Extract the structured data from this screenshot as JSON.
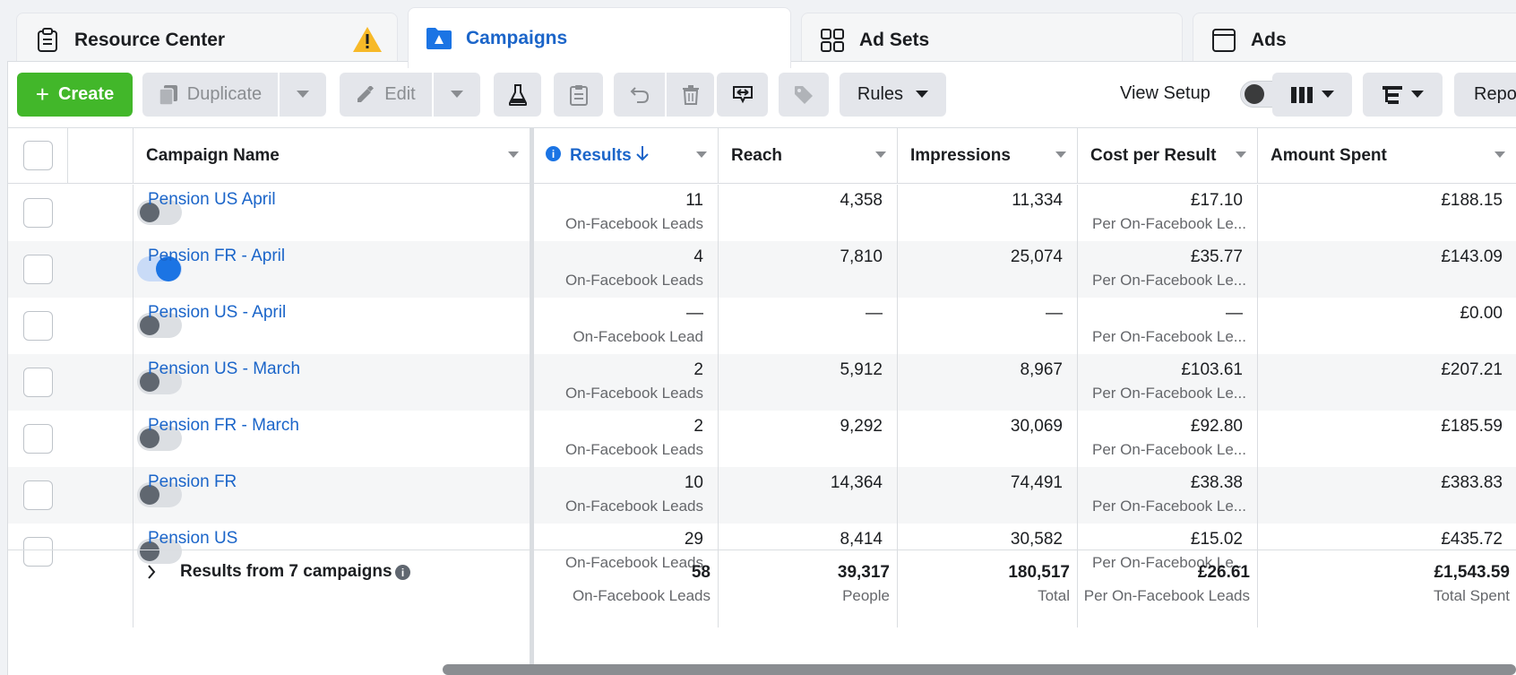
{
  "tabs": [
    {
      "label": "Resource Center",
      "icon": "clipboard-icon"
    },
    {
      "label": "Campaigns",
      "icon": "folder-icon"
    },
    {
      "label": "Ad Sets",
      "icon": "grid-icon"
    },
    {
      "label": "Ads",
      "icon": "ad-frame-icon"
    }
  ],
  "toolbar": {
    "create_label": "Create",
    "duplicate_label": "Duplicate",
    "edit_label": "Edit",
    "rules_label": "Rules",
    "view_setup_label": "View Setup",
    "reports_label": "Reports"
  },
  "columns": {
    "campaign_name": "Campaign Name",
    "results": "Results",
    "reach": "Reach",
    "impressions": "Impressions",
    "cost_per_result": "Cost per Result",
    "amount_spent": "Amount Spent"
  },
  "rows": [
    {
      "name": "Pension US April",
      "on": false,
      "results": "11",
      "results_sub": "On-Facebook Leads",
      "reach": "4,358",
      "impressions": "11,334",
      "cpr": "£17.10",
      "cpr_sub": "Per On-Facebook Le...",
      "spent": "£188.15"
    },
    {
      "name": "Pension FR - April",
      "on": true,
      "results": "4",
      "results_sub": "On-Facebook Leads",
      "reach": "7,810",
      "impressions": "25,074",
      "cpr": "£35.77",
      "cpr_sub": "Per On-Facebook Le...",
      "spent": "£143.09"
    },
    {
      "name": "Pension US - April",
      "on": false,
      "results": "—",
      "results_sub": "On-Facebook Lead",
      "reach": "—",
      "impressions": "—",
      "cpr": "—",
      "cpr_sub": "Per On-Facebook Le...",
      "spent": "£0.00"
    },
    {
      "name": "Pension US - March",
      "on": false,
      "results": "2",
      "results_sub": "On-Facebook Leads",
      "reach": "5,912",
      "impressions": "8,967",
      "cpr": "£103.61",
      "cpr_sub": "Per On-Facebook Le...",
      "spent": "£207.21"
    },
    {
      "name": "Pension FR - March",
      "on": false,
      "results": "2",
      "results_sub": "On-Facebook Leads",
      "reach": "9,292",
      "impressions": "30,069",
      "cpr": "£92.80",
      "cpr_sub": "Per On-Facebook Le...",
      "spent": "£185.59"
    },
    {
      "name": "Pension FR",
      "on": false,
      "results": "10",
      "results_sub": "On-Facebook Leads",
      "reach": "14,364",
      "impressions": "74,491",
      "cpr": "£38.38",
      "cpr_sub": "Per On-Facebook Le...",
      "spent": "£383.83"
    },
    {
      "name": "Pension US",
      "on": false,
      "results": "29",
      "results_sub": "On-Facebook Leads",
      "reach": "8,414",
      "impressions": "30,582",
      "cpr": "£15.02",
      "cpr_sub": "Per On-Facebook Le...",
      "spent": "£435.72"
    }
  ],
  "totals": {
    "label": "Results from 7 campaigns",
    "results": "58",
    "results_sub": "On-Facebook Leads",
    "reach": "39,317",
    "reach_sub": "People",
    "impressions": "180,517",
    "impressions_sub": "Total",
    "cpr": "£26.61",
    "cpr_sub": "Per On-Facebook Leads",
    "spent": "£1,543.59",
    "spent_sub": "Total Spent"
  },
  "colors": {
    "accent_blue": "#1b65c9",
    "create_green": "#42b72a",
    "warning_yellow": "#f7b928"
  }
}
